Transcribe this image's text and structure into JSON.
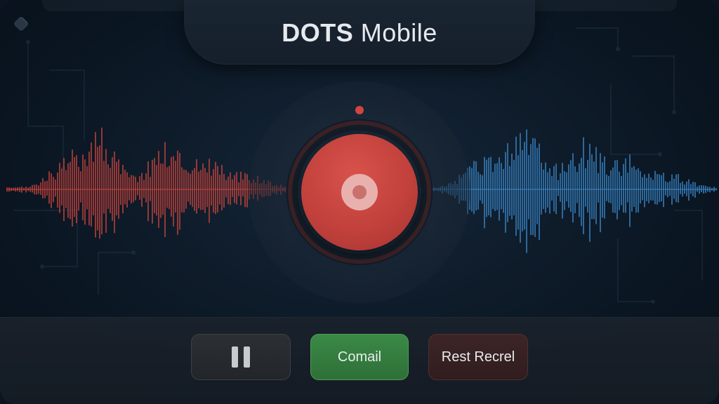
{
  "header": {
    "brand": "DOTS",
    "product": "Mobile"
  },
  "controls": {
    "pause_icon": "pause-icon",
    "cancel_label": "Comail",
    "reset_label": "Rest Recrel"
  },
  "colors": {
    "accent_record": "#c2413c",
    "waveform_left": "#c9443c",
    "waveform_right": "#3a86c8",
    "confirm_button": "#3b8a46",
    "reset_button": "#3d2526"
  },
  "status": {
    "recording": true
  }
}
